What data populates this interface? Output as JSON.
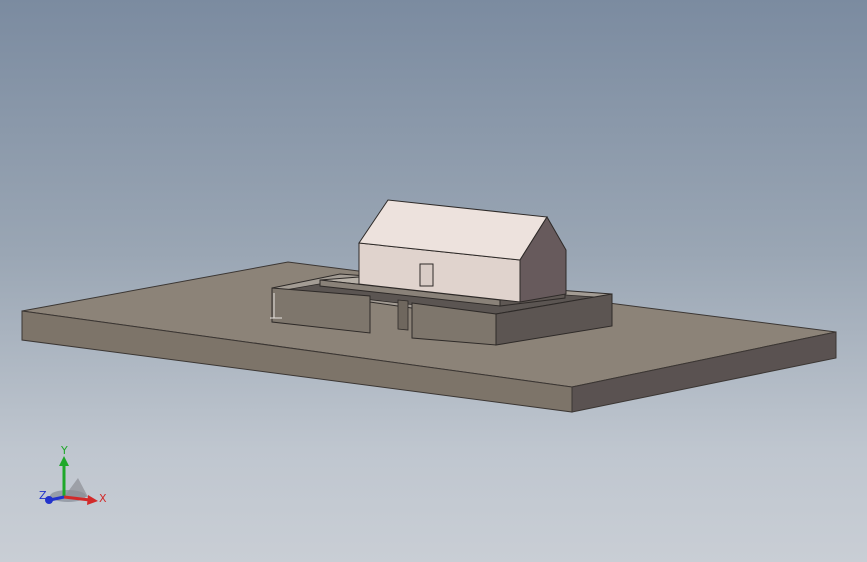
{
  "viewport": {
    "background_top": "#7b8ba0",
    "background_bottom": "#c9ced5"
  },
  "model": {
    "base_color_top": "#8c8378",
    "base_color_front": "#7b7268",
    "base_color_side": "#5a5250",
    "house_color_front": "#ede1dc",
    "house_color_side": "#6a5c5e"
  },
  "triad": {
    "x_label": "X",
    "y_label": "Y",
    "z_label": "Z",
    "x_color": "#d22a2a",
    "y_color": "#1fa82a",
    "z_color": "#2233cc"
  }
}
